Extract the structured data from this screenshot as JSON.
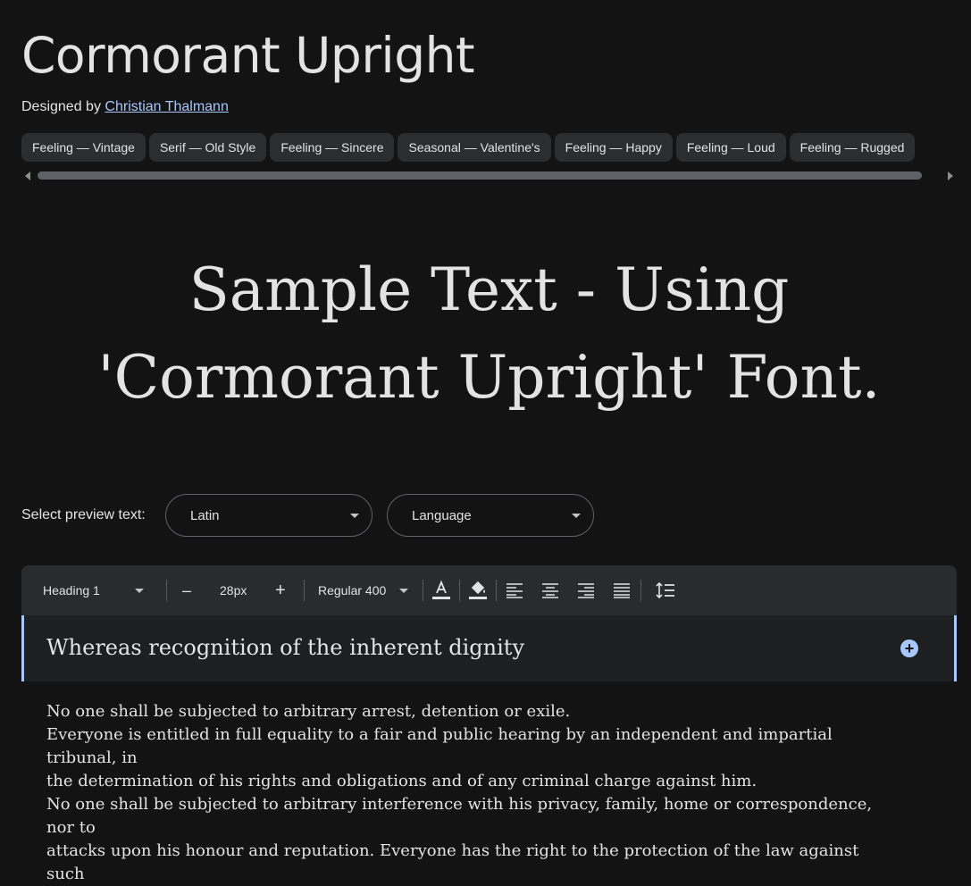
{
  "font": {
    "name": "Cormorant Upright",
    "designed_by_label": "Designed by",
    "designer": "Christian Thalmann"
  },
  "tags": [
    "Feeling — Vintage",
    "Serif — Old Style",
    "Feeling — Sincere",
    "Seasonal — Valentine's",
    "Feeling — Happy",
    "Feeling — Loud",
    "Feeling — Rugged"
  ],
  "sample_text": "Sample Text - Using 'Cormorant Upright' Font.",
  "preview": {
    "label": "Select preview text:",
    "script_value": "Latin",
    "language_placeholder": "Language"
  },
  "toolbar": {
    "style": "Heading 1",
    "decrease": "–",
    "size": "28px",
    "increase": "+",
    "weight": "Regular 400"
  },
  "editor": {
    "heading": "Whereas recognition of the inherent dignity",
    "lines": [
      "No one shall be subjected to arbitrary arrest, detention or exile.",
      "Everyone is entitled in full equality to a fair and public hearing by an independent and impartial tribunal, in",
      "the determination of his rights and obligations and of any criminal charge against him.",
      "No one shall be subjected to arbitrary interference with his privacy, family, home or correspondence, nor to",
      "attacks upon his honour and reputation. Everyone has the right to the protection of the law against such"
    ]
  },
  "colors": {
    "background": "#131314",
    "accent": "#a8c7fa",
    "chip": "#2c2d2f"
  }
}
